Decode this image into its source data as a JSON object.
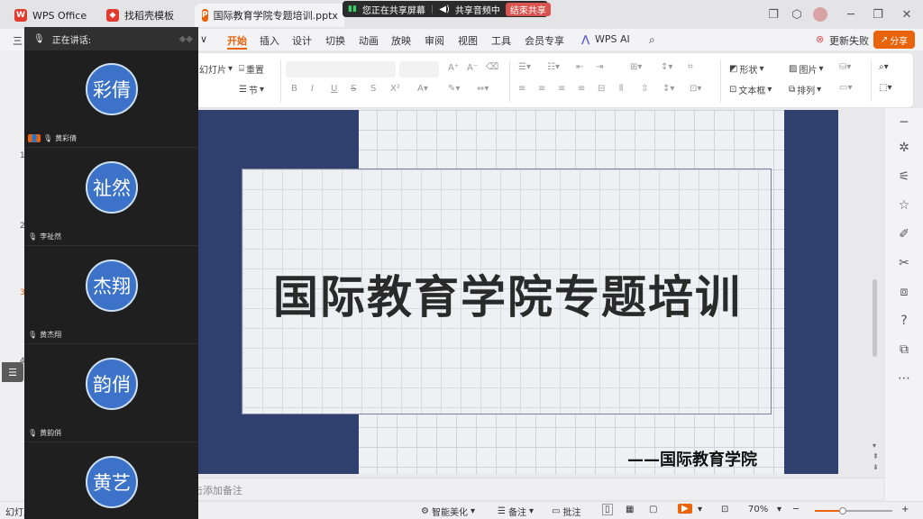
{
  "app": {
    "name": "WPS Office"
  },
  "tabs": [
    {
      "label": "WPS Office"
    },
    {
      "label": "找稻壳模板"
    },
    {
      "label": "国际教育学院专题培训.pptx"
    }
  ],
  "share_bar": {
    "status": "您正在共享屏幕",
    "audio": "共享音频中",
    "end": "结束共享"
  },
  "menu": {
    "items": [
      "开始",
      "插入",
      "设计",
      "切换",
      "动画",
      "放映",
      "审阅",
      "视图",
      "工具",
      "会员专享",
      "WPS AI"
    ],
    "active": "开始",
    "update": "更新失败",
    "share": "分享",
    "left_letter": "三"
  },
  "ribbon": {
    "slides_label": "幻灯片",
    "reset_label": "重置",
    "section_label": "节",
    "font_name_placeholder": "",
    "bold": "B",
    "italic": "I",
    "underline": "U",
    "strike": "S",
    "shadow": "S",
    "superscript": "X²",
    "shape": "形状",
    "picture": "图片",
    "textbox": "文本框",
    "arrange": "排列",
    "font_grow": "A⁺",
    "font_shrink": "A⁻"
  },
  "participants": {
    "speaking_label": "正在讲话:",
    "people": [
      {
        "avatar": "彩倩",
        "name": "黄彩倩"
      },
      {
        "avatar": "祉然",
        "name": "李祉然"
      },
      {
        "avatar": "杰翔",
        "name": "黄杰翔"
      },
      {
        "avatar": "韵俏",
        "name": "黄韵俏"
      },
      {
        "avatar": "黄艺",
        "name": ""
      }
    ]
  },
  "slide": {
    "title": "国际教育学院专题培训",
    "subtitle": "——国际教育学院"
  },
  "notes": {
    "placeholder": "单击此处添加备注",
    "visible_text": "击添加备注"
  },
  "left_numbers": [
    "1",
    "2",
    "3",
    "4"
  ],
  "statusbar": {
    "left": "幻灯片",
    "beautify": "智能美化",
    "notes": "备注",
    "comments": "批注",
    "zoom": "70%",
    "zoom_fraction": 0.36
  },
  "colors": {
    "accent": "#e8630a",
    "navy": "#2f3f6e",
    "avatar": "#3c73c8",
    "share_end": "#d9534f",
    "green_border": "#1fd46a"
  }
}
